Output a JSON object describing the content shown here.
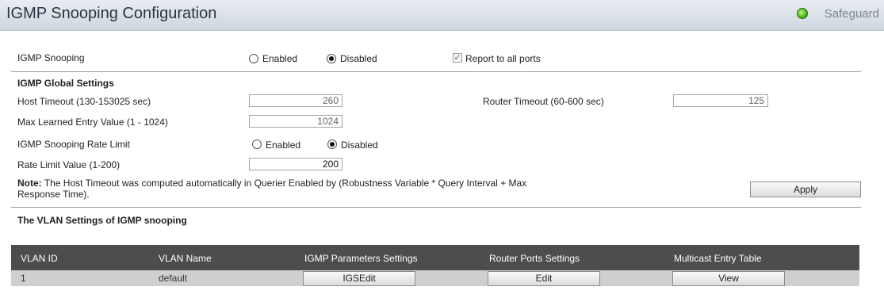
{
  "page": {
    "title": "IGMP Snooping Configuration",
    "safeguard_label": "Safeguard"
  },
  "snooping": {
    "label": "IGMP Snooping",
    "enabled_label": "Enabled",
    "disabled_label": "Disabled",
    "selected": "Disabled",
    "report_label": "Report to all ports",
    "report_checked": true
  },
  "global": {
    "heading": "IGMP Global Settings",
    "host_timeout_label": "Host Timeout (130-153025 sec)",
    "host_timeout_value": "260",
    "router_timeout_label": "Router Timeout (60-600 sec)",
    "router_timeout_value": "125",
    "max_entry_label": "Max Learned Entry Value (1 - 1024)",
    "max_entry_value": "1024",
    "rate_limit_label": "IGMP Snooping Rate Limit",
    "rate_enabled_label": "Enabled",
    "rate_disabled_label": "Disabled",
    "rate_selected": "Disabled",
    "rate_value_label": "Rate Limit Value (1-200)",
    "rate_value": "200",
    "note_bold": "Note:",
    "note_line1": "The Host Timeout was computed automatically in Querier Enabled by (Robustness Variable * Query Interval + Max",
    "note_line2": "Response Time).",
    "apply_label": "Apply"
  },
  "vlan": {
    "heading": "The VLAN Settings of IGMP snooping",
    "columns": [
      "VLAN ID",
      "VLAN Name",
      "IGMP Parameters Settings",
      "Router Ports Settings",
      "Multicast Entry Table"
    ],
    "rows": [
      {
        "vlan_id": "1",
        "vlan_name": "default",
        "igmp_btn": "IGSEdit",
        "router_btn": "Edit",
        "multicast_btn": "View"
      }
    ]
  },
  "colors": {
    "table_header": "#4b4d4f",
    "table_row": "#cfcfcf",
    "safeguard_led": "#48b817"
  }
}
